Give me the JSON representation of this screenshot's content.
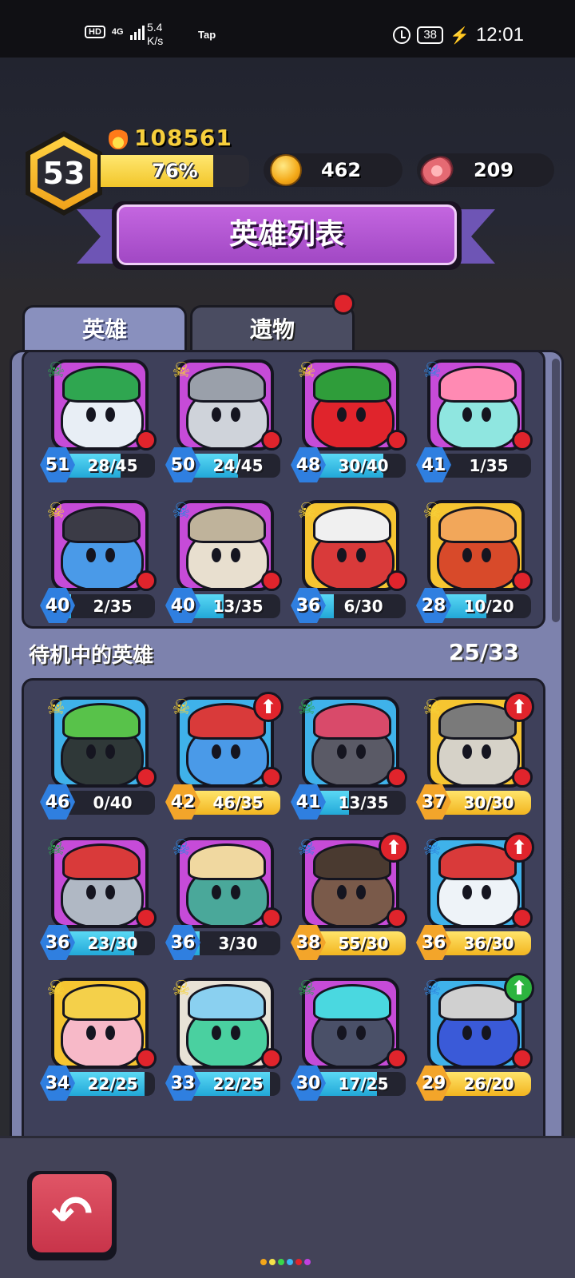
{
  "status_bar": {
    "hd": "HD",
    "network": "4G",
    "speed_value": "5.4",
    "speed_unit": "K/s",
    "app_label": "Tap",
    "battery": "38",
    "time": "12:01"
  },
  "player": {
    "level": "53",
    "power": "108561",
    "xp_percent_label": "76%",
    "xp_fraction": 0.76,
    "coins": "462",
    "meat": "209"
  },
  "title": "英雄列表",
  "tabs": [
    {
      "label": "英雄",
      "active": true
    },
    {
      "label": "遗物",
      "active": false,
      "has_notification": true
    }
  ],
  "team_heroes": [
    {
      "rank": "green-skull",
      "level": "51",
      "progress": "28/45",
      "fill": 0.62,
      "bar": "cyan",
      "bg": "#c64bd8",
      "body": "#e8eef5",
      "accent": "#2fa650"
    },
    {
      "rank": "gold-skull",
      "level": "50",
      "progress": "24/45",
      "fill": 0.53,
      "bar": "cyan",
      "bg": "#c64bd8",
      "body": "#cfd3da",
      "accent": "#9aa0aa"
    },
    {
      "rank": "gold-skull",
      "level": "48",
      "progress": "30/40",
      "fill": 0.75,
      "bar": "cyan",
      "bg": "#c64bd8",
      "body": "#e0242c",
      "accent": "#2f9d3a"
    },
    {
      "rank": "blue-skull",
      "level": "41",
      "progress": "1/35",
      "fill": 0.03,
      "bar": "cyan",
      "bg": "#c64bd8",
      "body": "#8fe6e0",
      "accent": "#ff8ab3"
    },
    {
      "rank": "gold-skull",
      "level": "40",
      "progress": "2/35",
      "fill": 0.06,
      "bar": "cyan",
      "bg": "#c64bd8",
      "body": "#4a9ae8",
      "accent": "#3b3b46"
    },
    {
      "rank": "blue-skull",
      "level": "40",
      "progress": "13/35",
      "fill": 0.37,
      "bar": "cyan",
      "bg": "#c64bd8",
      "body": "#e8dfcf",
      "accent": "#bfb39b"
    },
    {
      "rank": "gold-skull",
      "level": "36",
      "progress": "6/30",
      "fill": 0.2,
      "bar": "cyan",
      "bg": "#f6c531",
      "body": "#d93a3a",
      "accent": "#f0f0f0"
    },
    {
      "rank": "gold-skull",
      "level": "28",
      "progress": "10/20",
      "fill": 0.5,
      "bar": "cyan",
      "bg": "#f6c531",
      "body": "#d84a2a",
      "accent": "#f2a75a"
    }
  ],
  "standby": {
    "label": "待机中的英雄",
    "count": "25/33",
    "heroes": [
      {
        "rank": "gold-skull",
        "level": "46",
        "progress": "0/40",
        "fill": 0.0,
        "bar": "cyan",
        "bg": "#3fb2ea",
        "body": "#2f3838",
        "accent": "#58c24a",
        "upgrade": ""
      },
      {
        "rank": "gold-skull",
        "level": "42",
        "progress": "46/35",
        "fill": 1.0,
        "bar": "gold",
        "bg": "#3fb2ea",
        "body": "#4a9ae8",
        "accent": "#d93a3a",
        "upgrade": "red"
      },
      {
        "rank": "green-skull",
        "level": "41",
        "progress": "13/35",
        "fill": 0.37,
        "bar": "cyan",
        "bg": "#3fb2ea",
        "body": "#5a5a66",
        "accent": "#d94a6a",
        "upgrade": ""
      },
      {
        "rank": "gold-skull",
        "level": "37",
        "progress": "30/30",
        "fill": 1.0,
        "bar": "gold",
        "bg": "#f6c531",
        "body": "#d6d2c8",
        "accent": "#7a7a7a",
        "upgrade": "red"
      },
      {
        "rank": "green-skull",
        "level": "36",
        "progress": "23/30",
        "fill": 0.77,
        "bar": "cyan",
        "bg": "#c64bd8",
        "body": "#b0b8c4",
        "accent": "#d93a3a",
        "upgrade": ""
      },
      {
        "rank": "blue-skull",
        "level": "36",
        "progress": "3/30",
        "fill": 0.1,
        "bar": "cyan",
        "bg": "#c64bd8",
        "body": "#4aa89a",
        "accent": "#f0d8a0",
        "upgrade": ""
      },
      {
        "rank": "blue-skull",
        "level": "38",
        "progress": "55/30",
        "fill": 1.0,
        "bar": "gold",
        "bg": "#c64bd8",
        "body": "#7a5a4a",
        "accent": "#4a3a30",
        "upgrade": "red"
      },
      {
        "rank": "blue-skull",
        "level": "36",
        "progress": "36/30",
        "fill": 1.0,
        "bar": "gold",
        "bg": "#3fb2ea",
        "body": "#eef3f8",
        "accent": "#d93a3a",
        "upgrade": "red"
      },
      {
        "rank": "gold-skull",
        "level": "34",
        "progress": "22/25",
        "fill": 0.88,
        "bar": "cyan",
        "bg": "#f6c531",
        "body": "#f7b9c8",
        "accent": "#f4d04a",
        "upgrade": ""
      },
      {
        "rank": "gold-skull",
        "level": "33",
        "progress": "22/25",
        "fill": 0.88,
        "bar": "cyan",
        "bg": "#e8e2d6",
        "body": "#4ad0a0",
        "accent": "#8ad0f0",
        "upgrade": ""
      },
      {
        "rank": "green-skull",
        "level": "30",
        "progress": "17/25",
        "fill": 0.68,
        "bar": "cyan",
        "bg": "#c64bd8",
        "body": "#4a5068",
        "accent": "#4ad8e0",
        "upgrade": ""
      },
      {
        "rank": "blue-skull",
        "level": "29",
        "progress": "26/20",
        "fill": 1.0,
        "bar": "gold",
        "bg": "#3fb2ea",
        "body": "#3a5ad8",
        "accent": "#d0d0d0",
        "upgrade": "green"
      }
    ]
  },
  "nav": {
    "back_icon": "↶"
  },
  "colors": {
    "accent_purple": "#a148c4",
    "panel": "#7d82ad",
    "notification_red": "#e0242c"
  }
}
